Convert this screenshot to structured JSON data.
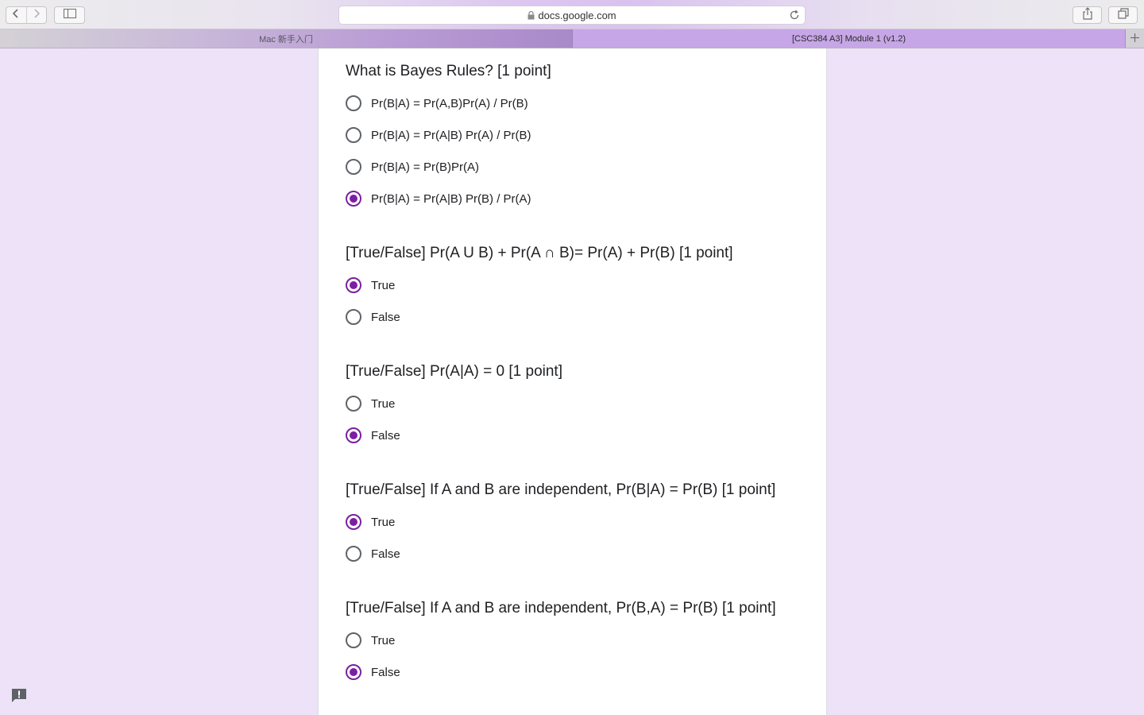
{
  "browser": {
    "url": "docs.google.com",
    "tabs": [
      {
        "label": "Mac 新手入门"
      },
      {
        "label": "[CSC384 A3] Module 1 (v1.2)"
      }
    ]
  },
  "questions": [
    {
      "title": "What is Bayes Rules? [1 point]",
      "options": [
        {
          "label": "Pr(B|A) = Pr(A,B)Pr(A) / Pr(B)",
          "selected": false
        },
        {
          "label": "Pr(B|A) = Pr(A|B) Pr(A) / Pr(B)",
          "selected": false
        },
        {
          "label": "Pr(B|A) = Pr(B)Pr(A)",
          "selected": false
        },
        {
          "label": "Pr(B|A) = Pr(A|B) Pr(B) / Pr(A)",
          "selected": true
        }
      ]
    },
    {
      "title": "[True/False] Pr(A U B) + Pr(A ∩ B)= Pr(A) + Pr(B) [1 point]",
      "options": [
        {
          "label": "True",
          "selected": true
        },
        {
          "label": "False",
          "selected": false
        }
      ]
    },
    {
      "title": "[True/False] Pr(A|A) = 0 [1 point]",
      "options": [
        {
          "label": "True",
          "selected": false
        },
        {
          "label": "False",
          "selected": true
        }
      ]
    },
    {
      "title": "[True/False] If A and B are independent, Pr(B|A) = Pr(B) [1 point]",
      "options": [
        {
          "label": "True",
          "selected": true
        },
        {
          "label": "False",
          "selected": false
        }
      ]
    },
    {
      "title": "[True/False] If A and B are independent, Pr(B,A) = Pr(B) [1 point]",
      "options": [
        {
          "label": "True",
          "selected": false
        },
        {
          "label": "False",
          "selected": true
        }
      ]
    }
  ],
  "colors": {
    "accent": "#7b1fa2",
    "page_background": "#ede2f8"
  }
}
